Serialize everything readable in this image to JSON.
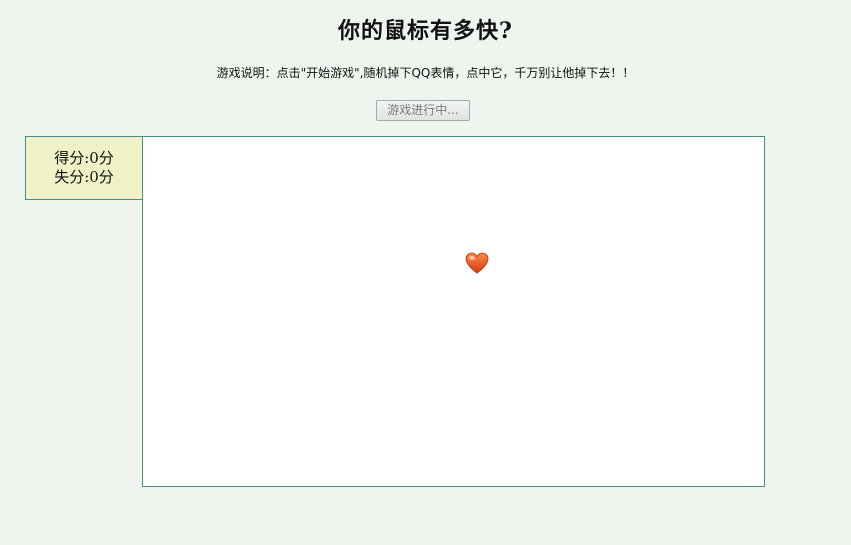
{
  "page": {
    "title": "你的鼠标有多快?",
    "instructions": "游戏说明：点击\"开始游戏\",随机掉下QQ表情，点中它，千万别让他掉下去！！"
  },
  "controls": {
    "start_button_label": "游戏进行中..."
  },
  "score_panel": {
    "score_label": "得分:",
    "score_value": "0",
    "score_unit": "分",
    "miss_label": "失分:",
    "miss_value": "0",
    "miss_unit": "分"
  },
  "game": {
    "emoji_icon": "heart-icon",
    "colors": {
      "heart_top": "#ff7a3a",
      "heart_bottom": "#d93a10",
      "border": "#4a8a8a",
      "page_background": "#eef5ee",
      "score_background": "#eef2c6"
    }
  }
}
